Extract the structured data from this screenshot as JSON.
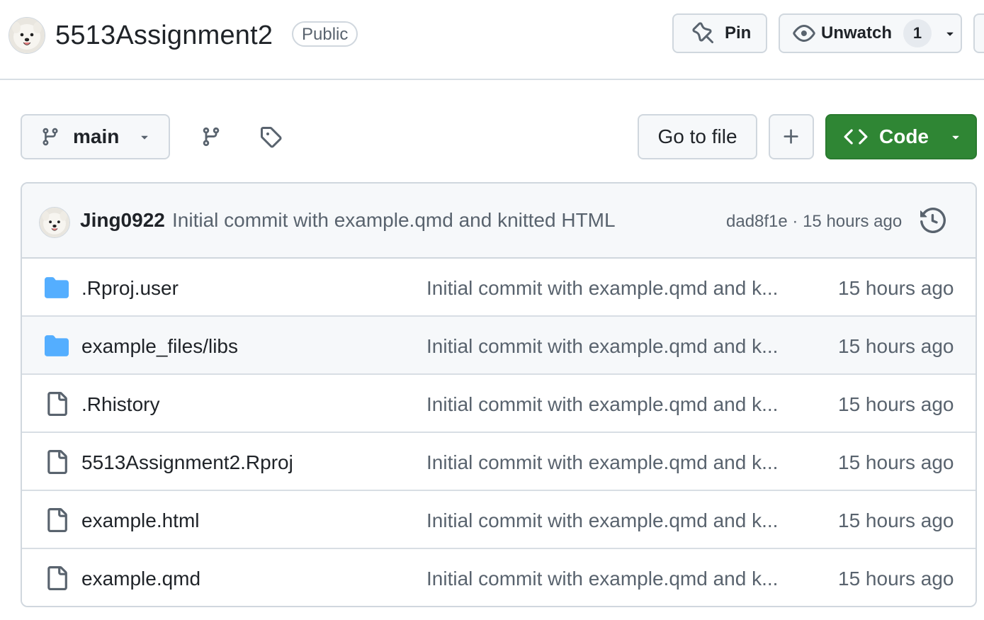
{
  "repo": {
    "name": "5513Assignment2",
    "visibility": "Public"
  },
  "header_buttons": {
    "pin_label": "Pin",
    "watch_label": "Unwatch",
    "watch_count": "1"
  },
  "toolbar": {
    "branch": "main",
    "goto_file": "Go to file",
    "code_label": "Code"
  },
  "latest_commit": {
    "author": "Jing0922",
    "message": "Initial commit with example.qmd and knitted HTML",
    "meta": "dad8f1e · 15 hours ago"
  },
  "files": [
    {
      "type": "folder",
      "name": ".Rproj.user",
      "commit": "Initial commit with example.qmd and k...",
      "age": "15 hours ago"
    },
    {
      "type": "folder",
      "name": "example_files/libs",
      "commit": "Initial commit with example.qmd and k...",
      "age": "15 hours ago"
    },
    {
      "type": "file",
      "name": ".Rhistory",
      "commit": "Initial commit with example.qmd and k...",
      "age": "15 hours ago"
    },
    {
      "type": "file",
      "name": "5513Assignment2.Rproj",
      "commit": "Initial commit with example.qmd and k...",
      "age": "15 hours ago"
    },
    {
      "type": "file",
      "name": "example.html",
      "commit": "Initial commit with example.qmd and k...",
      "age": "15 hours ago"
    },
    {
      "type": "file",
      "name": "example.qmd",
      "commit": "Initial commit with example.qmd and k...",
      "age": "15 hours ago"
    }
  ],
  "colors": {
    "code_button": "#2f8634",
    "folder_icon": "#54aeff",
    "muted_text": "#59636e"
  },
  "icons": {
    "avatar": "samoyed-dog-avatar",
    "pin": "pin-icon",
    "watch": "eye-icon",
    "branch": "git-branch-icon",
    "tag": "tag-icon",
    "add": "plus-icon",
    "code": "code-icon",
    "history": "history-icon",
    "folder": "folder-icon",
    "file": "file-icon"
  }
}
